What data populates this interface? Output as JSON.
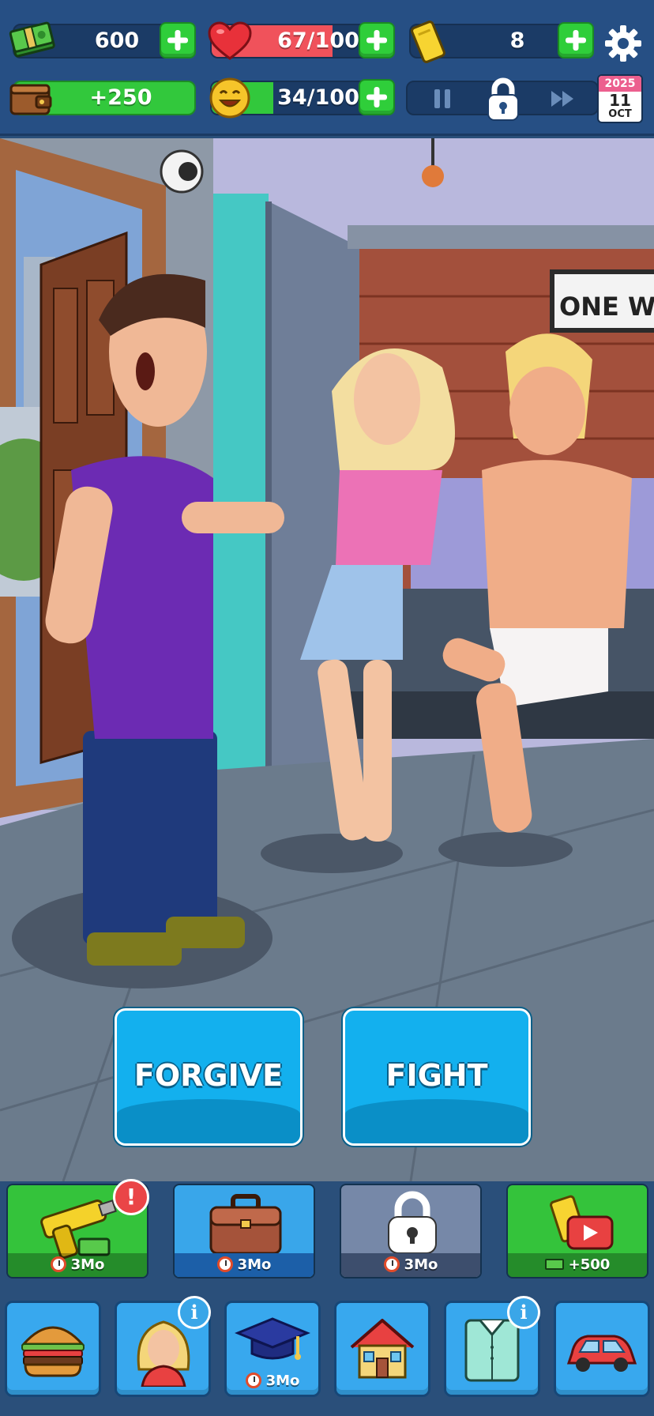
{
  "hud": {
    "cash": "600",
    "health": "67/100",
    "health_fraction": 0.67,
    "tickets": "8",
    "wallet_income": "+250",
    "happiness": "34/100",
    "happiness_fraction": 0.34,
    "date": {
      "year": "2025",
      "day": "11",
      "month": "OCT"
    }
  },
  "scene": {
    "sign_text": "ONE WA",
    "choices": {
      "forgive": "FORGIVE",
      "fight": "FIGHT"
    }
  },
  "actions": [
    {
      "name": "work-gun",
      "label": "3Mo"
    },
    {
      "name": "business",
      "label": "3Mo"
    },
    {
      "name": "locked",
      "label": "3Mo"
    },
    {
      "name": "video-reward",
      "label": "+500"
    }
  ],
  "nav": {
    "education_label": "3Mo"
  },
  "colors": {
    "accent_green": "#2fce3a",
    "health_red": "#f0525b",
    "button_blue": "#13b0ee",
    "hud_blue": "#264f84"
  }
}
